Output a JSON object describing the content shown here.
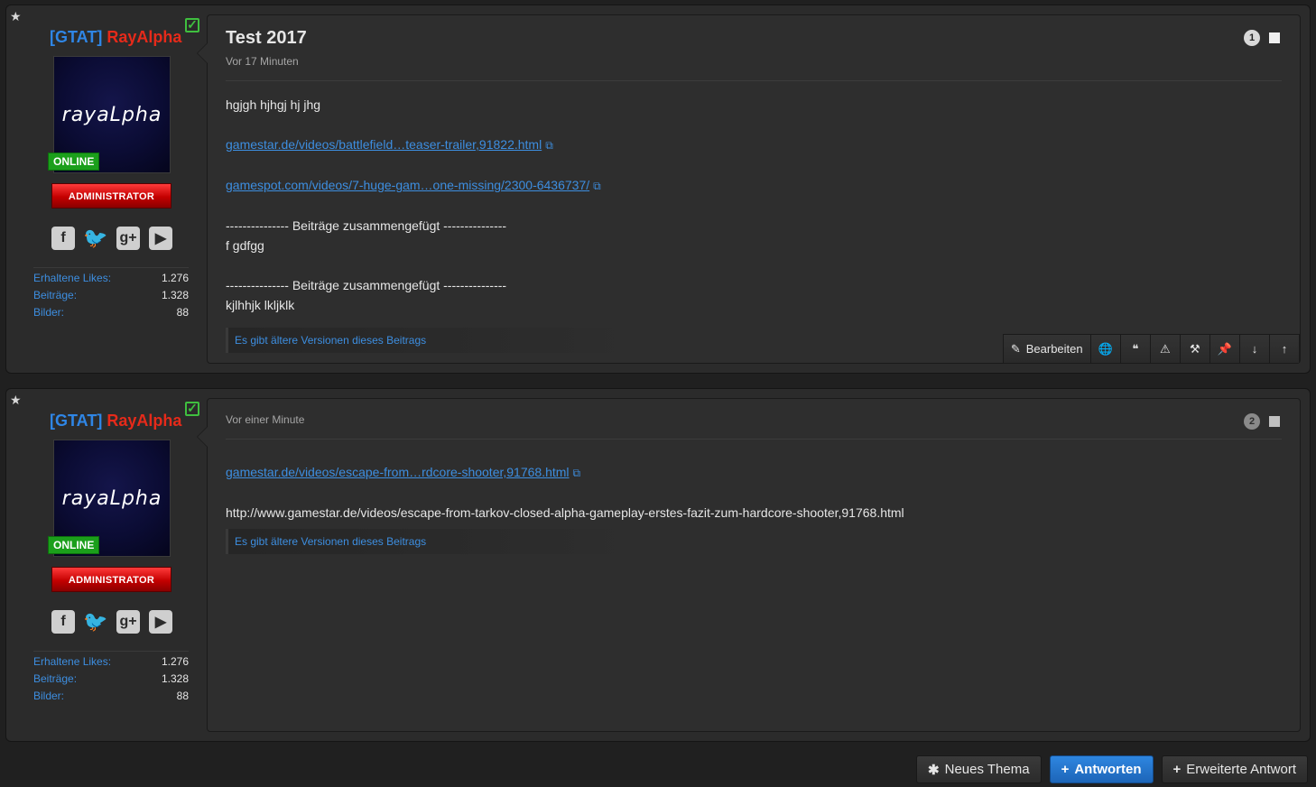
{
  "posts": [
    {
      "user": {
        "tag": "[GTAT]",
        "nick": "RayAlpha",
        "avatar_text": "rayaLpha",
        "online": "ONLINE",
        "rank": "ADMINISTRATOR",
        "stats": [
          {
            "label": "Erhaltene Likes:",
            "value": "1.276"
          },
          {
            "label": "Beiträge:",
            "value": "1.328"
          },
          {
            "label": "Bilder:",
            "value": "88"
          }
        ]
      },
      "title": "Test 2017",
      "time": "Vor 17 Minuten",
      "number": "1",
      "body": {
        "line1": "hgjgh hjhgj hj jhg",
        "link1": "gamestar.de/videos/battlefield…teaser-trailer,91822.html",
        "link2": "gamespot.com/videos/7-huge-gam…one-missing/2300-6436737/",
        "merged1": "--------------- Beiträge zusammengefügt ---------------",
        "line2": "f gdfgg",
        "merged2": "--------------- Beiträge zusammengefügt ---------------",
        "line3": "kjlhhjk lkljklk"
      },
      "versions": "Es gibt ältere Versionen dieses Beitrags",
      "toolbar": {
        "edit": "Bearbeiten"
      }
    },
    {
      "user": {
        "tag": "[GTAT]",
        "nick": "RayAlpha",
        "avatar_text": "rayaLpha",
        "online": "ONLINE",
        "rank": "ADMINISTRATOR",
        "stats": [
          {
            "label": "Erhaltene Likes:",
            "value": "1.276"
          },
          {
            "label": "Beiträge:",
            "value": "1.328"
          },
          {
            "label": "Bilder:",
            "value": "88"
          }
        ]
      },
      "time": "Vor einer Minute",
      "number": "2",
      "body": {
        "link1": "gamestar.de/videos/escape-from…rdcore-shooter,91768.html",
        "line1": "http://www.gamestar.de/videos/escape-from-tarkov-closed-alpha-gameplay-erstes-fazit-zum-hardcore-shooter,91768.html"
      },
      "versions": "Es gibt ältere Versionen dieses Beitrags"
    }
  ],
  "bottom": {
    "new_thread": "Neues Thema",
    "reply": "Antworten",
    "extended_reply": "Erweiterte Antwort"
  },
  "icons": [
    "star-icon",
    "check-icon",
    "facebook-icon",
    "twitter-icon",
    "google-plus-icon",
    "youtube-icon",
    "external-link-icon",
    "pencil-icon",
    "globe-icon",
    "quote-icon",
    "warning-icon",
    "hammer-icon",
    "pin-icon",
    "arrow-down-icon",
    "arrow-up-icon",
    "asterisk-icon",
    "plus-icon"
  ]
}
